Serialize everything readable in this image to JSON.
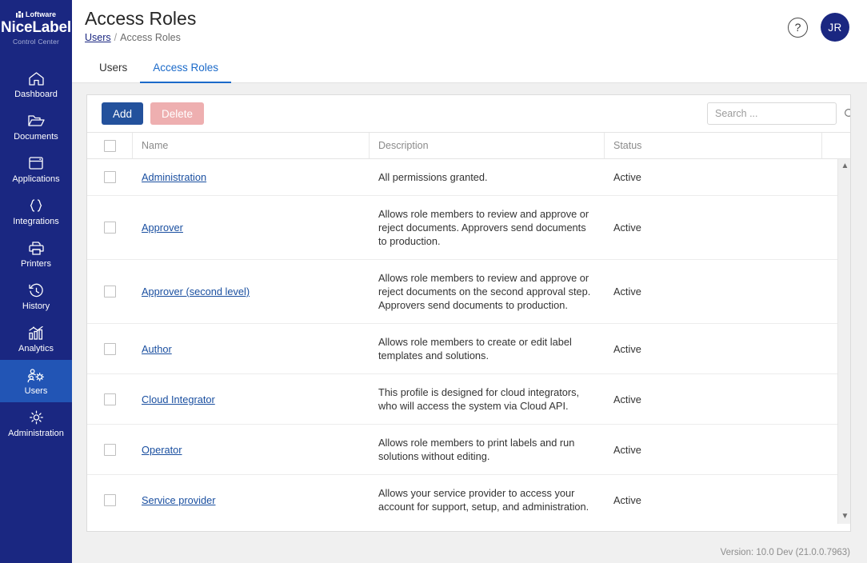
{
  "brand": {
    "loftware": "Loftware",
    "product": "NiceLabel",
    "subtitle": "Control Center"
  },
  "sidebar": {
    "items": [
      {
        "label": "Dashboard",
        "icon": "home-icon",
        "active": false
      },
      {
        "label": "Documents",
        "icon": "folder-icon",
        "active": false
      },
      {
        "label": "Applications",
        "icon": "window-icon",
        "active": false
      },
      {
        "label": "Integrations",
        "icon": "braces-icon",
        "active": false
      },
      {
        "label": "Printers",
        "icon": "printer-icon",
        "active": false
      },
      {
        "label": "History",
        "icon": "clock-history-icon",
        "active": false
      },
      {
        "label": "Analytics",
        "icon": "bar-chart-icon",
        "active": false
      },
      {
        "label": "Users",
        "icon": "users-gear-icon",
        "active": true
      },
      {
        "label": "Administration",
        "icon": "gear-icon",
        "active": false
      }
    ]
  },
  "header": {
    "title": "Access Roles",
    "breadcrumb": {
      "parent": "Users",
      "separator": "/",
      "current": "Access Roles"
    },
    "help_icon": "question-mark-icon",
    "avatar_initials": "JR"
  },
  "tabs": [
    {
      "label": "Users",
      "active": false
    },
    {
      "label": "Access Roles",
      "active": true
    }
  ],
  "toolbar": {
    "add_label": "Add",
    "delete_label": "Delete",
    "search_placeholder": "Search ...",
    "search_value": "",
    "search_icon": "magnifier-icon"
  },
  "table": {
    "columns": [
      "Name",
      "Description",
      "Status"
    ],
    "rows": [
      {
        "name": "Administration",
        "description": "All permissions granted.",
        "status": "Active"
      },
      {
        "name": "Approver",
        "description": "Allows role members to review and approve or reject documents. Approvers send documents to production.",
        "status": "Active"
      },
      {
        "name": "Approver (second level)",
        "description": "Allows role members to review and approve or reject documents on the second approval step. Approvers send documents to production.",
        "status": "Active"
      },
      {
        "name": "Author",
        "description": "Allows role members to create or edit label templates and solutions.",
        "status": "Active"
      },
      {
        "name": "Cloud Integrator",
        "description": "This profile is designed for cloud integrators, who will access the system via Cloud API.",
        "status": "Active"
      },
      {
        "name": "Operator",
        "description": "Allows role members to print labels and run solutions without editing.",
        "status": "Active"
      },
      {
        "name": "Service provider",
        "description": "Allows your service provider to access your account for support, setup, and administration.",
        "status": "Active"
      }
    ],
    "scroll_up_icon": "chevron-up-icon",
    "scroll_down_icon": "chevron-down-icon"
  },
  "footer": {
    "version": "Version: 10.0 Dev (21.0.0.7963)"
  },
  "colors": {
    "sidebar_bg": "#1a2781",
    "sidebar_active": "#2255b5",
    "accent_blue": "#1b6ac9",
    "add_button": "#23519c",
    "delete_button": "#eeafb0",
    "link": "#1a4fa0",
    "page_bg": "#f0f0f0"
  }
}
